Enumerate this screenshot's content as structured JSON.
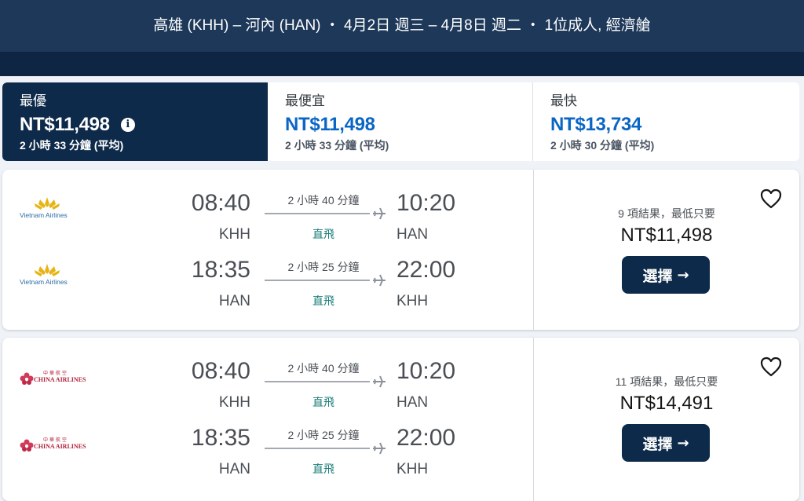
{
  "header": {
    "title": "高雄 (KHH) – 河內 (HAN) ・ 4月2日 週三 – 4月8日 週二 ・ 1位成人, 經濟艙"
  },
  "sort_tabs": [
    {
      "label": "最優",
      "price": "NT$11,498",
      "sub": "2 小時 33 分鐘 (平均)",
      "selected": true,
      "icon": "info-icon"
    },
    {
      "label": "最便宜",
      "price": "NT$11,498",
      "sub": "2 小時 33 分鐘 (平均)",
      "selected": false
    },
    {
      "label": "最快",
      "price": "NT$13,734",
      "sub": "2 小時 30 分鐘 (平均)",
      "selected": false
    }
  ],
  "results": [
    {
      "airline": "Vietnam Airlines",
      "legs": [
        {
          "dep_time": "08:40",
          "dep_code": "KHH",
          "duration": "2 小時 40 分鐘",
          "stops": "直飛",
          "arr_time": "10:20",
          "arr_code": "HAN"
        },
        {
          "dep_time": "18:35",
          "dep_code": "HAN",
          "duration": "2 小時 25 分鐘",
          "stops": "直飛",
          "arr_time": "22:00",
          "arr_code": "KHH"
        }
      ],
      "results_text": "9 項結果，最低只要",
      "price": "NT$11,498",
      "select_label": "選擇"
    },
    {
      "airline": "CHINA AIRLINES",
      "airline_native": "中華航空",
      "legs": [
        {
          "dep_time": "08:40",
          "dep_code": "KHH",
          "duration": "2 小時 40 分鐘",
          "stops": "直飛",
          "arr_time": "10:20",
          "arr_code": "HAN"
        },
        {
          "dep_time": "18:35",
          "dep_code": "HAN",
          "duration": "2 小時 25 分鐘",
          "stops": "直飛",
          "arr_time": "22:00",
          "arr_code": "KHH"
        }
      ],
      "results_text": "11 項結果，最低只要",
      "price": "NT$14,491",
      "select_label": "選擇"
    }
  ],
  "colors": {
    "navy": "#0e2a4a",
    "price_blue": "#0a66c4",
    "nonstop_teal": "#1b7f79",
    "va_gold": "#e7b416",
    "ca_red": "#b0213a"
  }
}
